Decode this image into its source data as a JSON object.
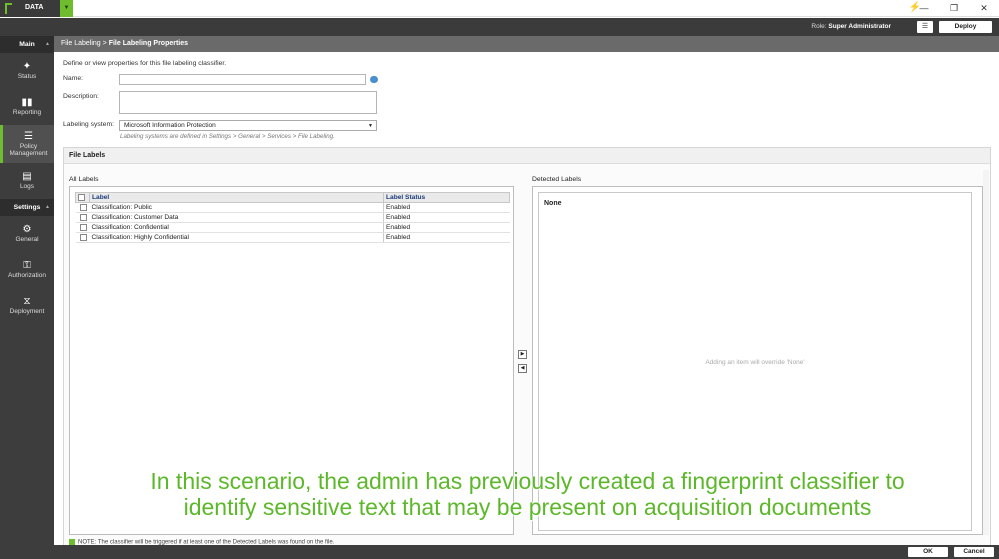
{
  "app": {
    "name": "DATA",
    "role_label": "Role:",
    "role_value": "Super Administrator",
    "deploy": "Deploy"
  },
  "window": {
    "minimize": "—",
    "restore": "❐",
    "close": "✕"
  },
  "sidebar": {
    "main_label": "Main",
    "settings_label": "Settings",
    "items": [
      {
        "label": "Status",
        "icon": "status-icon"
      },
      {
        "label": "Reporting",
        "icon": "chart-icon"
      },
      {
        "label": "Policy Management",
        "icon": "policy-icon"
      },
      {
        "label": "Logs",
        "icon": "logs-icon"
      }
    ],
    "settings_items": [
      {
        "label": "General",
        "icon": "gear-icon"
      },
      {
        "label": "Authorization",
        "icon": "key-icon"
      },
      {
        "label": "Deployment",
        "icon": "network-icon"
      }
    ]
  },
  "breadcrumb": {
    "parent": "File Labeling",
    "separator": " > ",
    "current": "File Labeling Properties"
  },
  "form": {
    "intro": "Define or view properties for this file labeling classifier.",
    "name_label": "Name:",
    "name_value": "",
    "description_label": "Description:",
    "description_value": "",
    "system_label": "Labeling system:",
    "system_value": "Microsoft Information Protection",
    "system_hint": "Labeling systems are defined in Settings > General > Services > File Labeling."
  },
  "file_labels": {
    "header": "File Labels",
    "all_title": "All Labels",
    "columns": [
      "Label",
      "Label Status"
    ],
    "rows": [
      {
        "label": "Classification: Public",
        "status": "Enabled"
      },
      {
        "label": "Classification: Customer Data",
        "status": "Enabled"
      },
      {
        "label": "Classification: Confidential",
        "status": "Enabled"
      },
      {
        "label": "Classification: Highly Confidential",
        "status": "Enabled"
      }
    ],
    "detected_title": "Detected Labels",
    "detected_none": "None",
    "detected_hint": "Adding an item will override 'None'",
    "note": "NOTE: The classifier will be triggered if at least one of the Detected Labels was found on the file."
  },
  "footer": {
    "ok": "OK",
    "cancel": "Cancel"
  },
  "caption": {
    "line1": "In this scenario, the admin has previously created a fingerprint classifier to",
    "line2": "identify sensitive text that may be present on acquisition documents"
  },
  "colors": {
    "accent": "#6dbd2e",
    "dark": "#3b3b3b"
  }
}
